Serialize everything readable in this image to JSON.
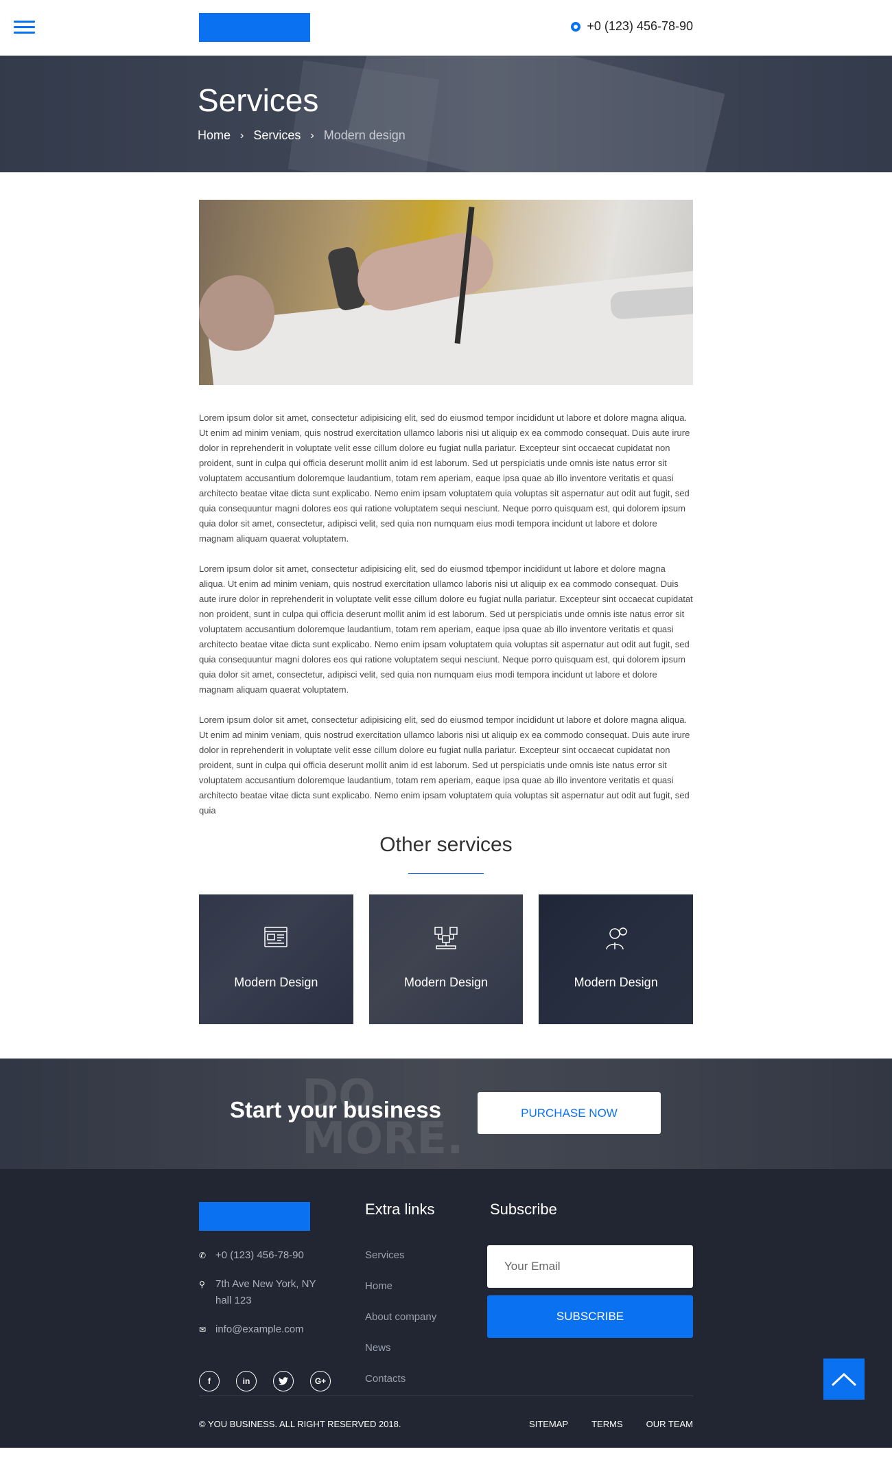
{
  "header": {
    "phone": "+0 (123) 456-78-90"
  },
  "banner": {
    "title": "Services",
    "breadcrumb": [
      "Home",
      "Services",
      "Modern design"
    ]
  },
  "content": {
    "paragraphs": [
      "Lorem ipsum dolor sit amet, consectetur adipisicing elit, sed do eiusmod tempor incididunt ut labore et dolore magna aliqua. Ut enim ad minim veniam, quis nostrud exercitation ullamco laboris nisi ut aliquip ex ea commodo consequat. Duis aute irure dolor in reprehenderit in voluptate velit esse cillum dolore eu fugiat nulla pariatur. Excepteur sint occaecat cupidatat non proident, sunt in culpa qui officia deserunt mollit anim id est laborum. Sed ut perspiciatis unde omnis iste natus error sit voluptatem accusantium doloremque laudantium, totam rem aperiam, eaque ipsa quae ab illo inventore veritatis et quasi architecto beatae vitae dicta sunt explicabo. Nemo enim ipsam voluptatem quia voluptas sit aspernatur aut odit aut fugit, sed quia consequuntur magni dolores eos qui ratione voluptatem sequi nesciunt. Neque porro quisquam est, qui dolorem ipsum quia dolor sit amet, consectetur, adipisci velit, sed quia non numquam eius modi tempora incidunt ut labore et dolore magnam aliquam quaerat voluptatem.",
      "Lorem ipsum dolor sit amet, consectetur adipisicing elit, sed do eiusmod tфempor incididunt ut labore et dolore magna aliqua. Ut enim ad minim veniam, quis nostrud exercitation ullamco laboris nisi ut aliquip ex ea commodo consequat. Duis aute irure dolor in reprehenderit in voluptate velit esse cillum dolore eu fugiat nulla pariatur. Excepteur sint occaecat cupidatat non proident, sunt in culpa qui officia deserunt mollit anim id est laborum. Sed ut perspiciatis unde omnis iste natus error sit voluptatem accusantium doloremque laudantium, totam rem aperiam, eaque ipsa quae ab illo inventore veritatis et quasi architecto beatae vitae dicta sunt explicabo. Nemo enim ipsam voluptatem quia voluptas sit aspernatur aut odit aut fugit, sed quia consequuntur magni dolores eos qui ratione voluptatem sequi nesciunt. Neque porro quisquam est, qui dolorem ipsum quia dolor sit amet, consectetur, adipisci velit, sed quia non numquam eius modi tempora incidunt ut labore et dolore magnam aliquam quaerat voluptatem.",
      "Lorem ipsum dolor sit amet, consectetur adipisicing elit, sed do eiusmod tempor incididunt ut labore et dolore magna aliqua. Ut enim ad minim veniam, quis nostrud exercitation ullamco laboris nisi ut aliquip ex ea commodo consequat. Duis aute irure dolor in reprehenderit in voluptate velit esse cillum dolore eu fugiat nulla pariatur. Excepteur sint occaecat cupidatat non proident, sunt in culpa qui officia deserunt mollit anim id est laborum. Sed ut perspiciatis unde omnis iste natus error sit voluptatem accusantium doloremque laudantium, totam rem aperiam, eaque ipsa quae ab illo inventore veritatis et quasi architecto beatae vitae dicta sunt explicabo. Nemo enim ipsam voluptatem quia voluptas sit aspernatur aut odit aut fugit, sed quia"
    ]
  },
  "other_services": {
    "title": "Other services",
    "cards": [
      {
        "label": "Modern Design",
        "icon": "web-design-icon"
      },
      {
        "label": "Modern Design",
        "icon": "network-icon"
      },
      {
        "label": "Modern Design",
        "icon": "developer-icon"
      }
    ]
  },
  "cta": {
    "title": "Start your business",
    "button": "PURCHASE NOW",
    "background_text": "DO MORE."
  },
  "footer": {
    "phone": "+0 (123) 456-78-90",
    "address_line1": "7th Ave New York, NY",
    "address_line2": "hall 123",
    "email": "info@example.com",
    "socials": [
      "facebook-icon",
      "linkedin-icon",
      "twitter-icon",
      "google-plus-icon"
    ],
    "extra_links_title": "Extra links",
    "extra_links": [
      "Services",
      "Home",
      "About company",
      "News",
      "Contacts"
    ],
    "subscribe_title": "Subscribe",
    "email_placeholder": "Your Email",
    "subscribe_button": "SUBSCRIBE",
    "copyright": "© YOU BUSINESS. ALL RIGHT RESERVED 2018.",
    "nav": [
      "SITEMAP",
      "TERMS",
      "OUR TEAM"
    ]
  },
  "colors": {
    "accent": "#0a72f0",
    "footer_bg": "#222633"
  }
}
